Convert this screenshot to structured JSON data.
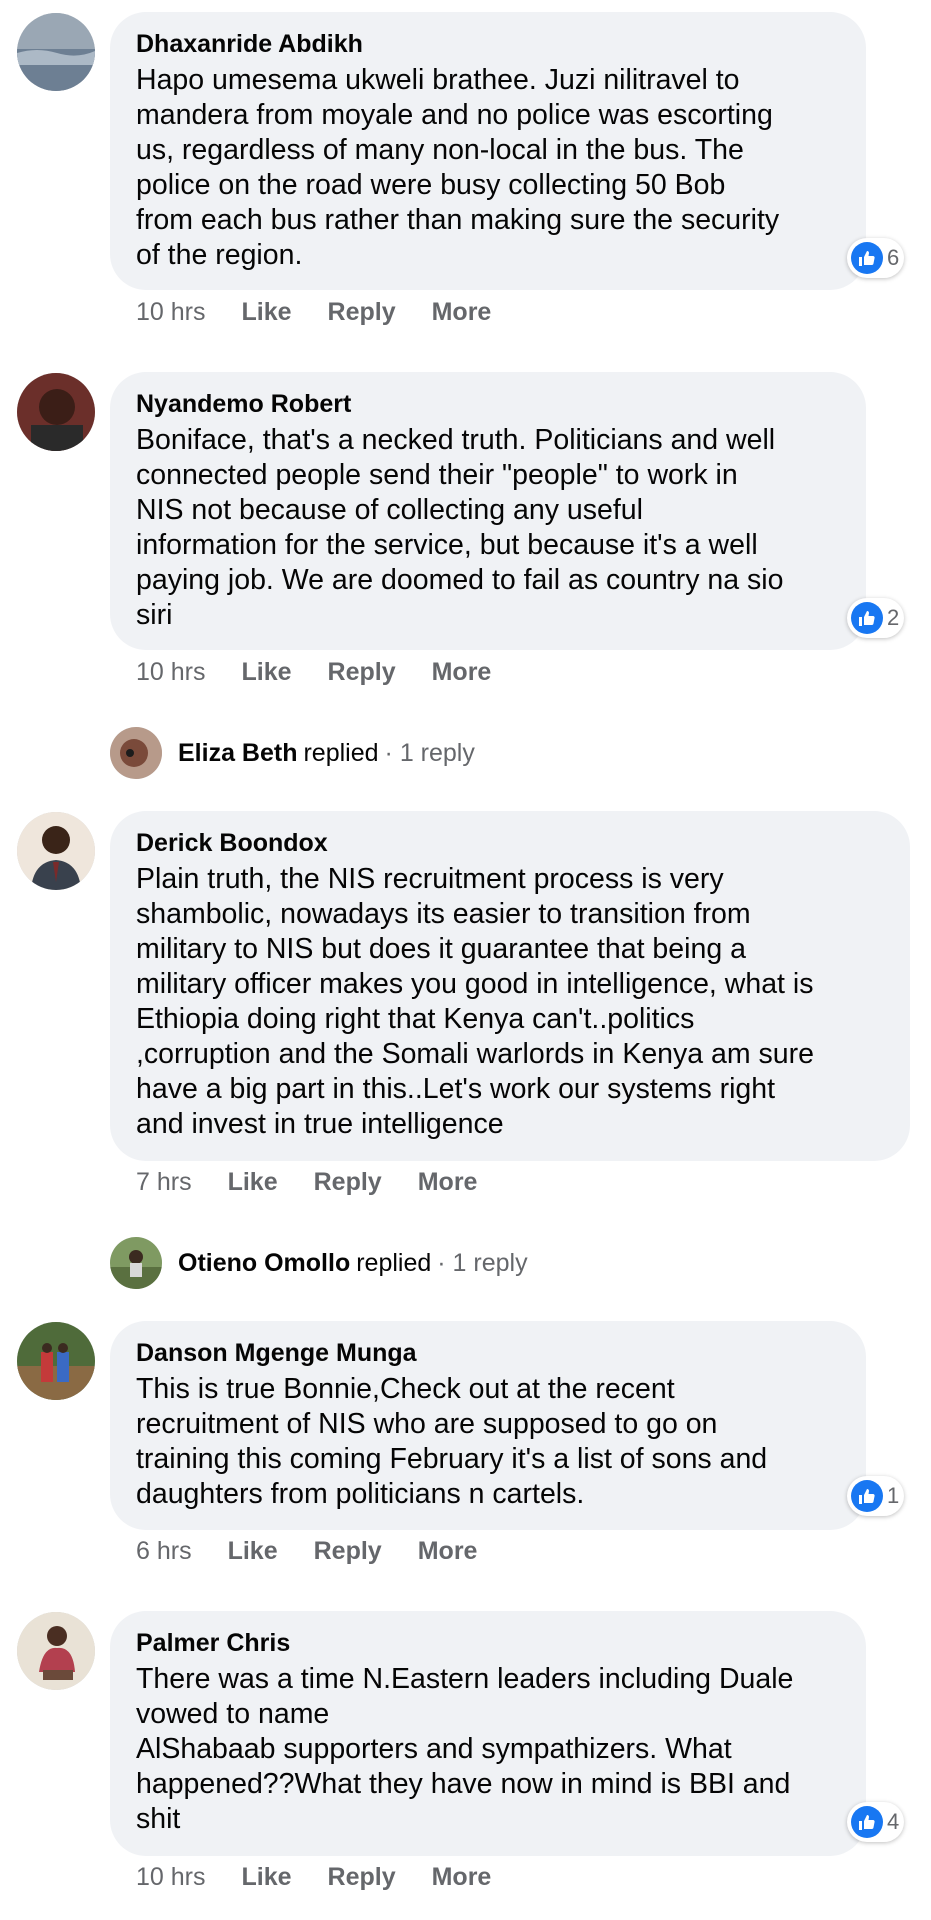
{
  "comments": [
    {
      "author": "Dhaxanride Abdikh",
      "text": "Hapo umesema ukweli brathee. Juzi nilitravel to\nmandera from moyale and no police was escorting\nus, regardless of many non-local in the bus. The\npolice on the road were busy collecting 50 Bob\nfrom each bus rather than making sure the security\nof the region.",
      "likes": "6",
      "time": "10 hrs",
      "like_label": "Like",
      "reply_label": "Reply",
      "more_label": "More"
    },
    {
      "author": "Nyandemo Robert",
      "text": "Boniface, that's a necked truth. Politicians and well\nconnected people send their \"people\" to work in\nNIS not because of collecting any useful\ninformation for the service, but because it's a well\npaying job. We are doomed to fail as country na sio\nsiri",
      "likes": "2",
      "time": "10 hrs",
      "like_label": "Like",
      "reply_label": "Reply",
      "more_label": "More",
      "replied": {
        "name": "Eliza Beth",
        "word": "replied",
        "count": "· 1 reply"
      }
    },
    {
      "author": "Derick Boondox",
      "text": "Plain truth, the NIS recruitment process is very\nshambolic, nowadays its easier to transition from\nmilitary to NIS but does it guarantee that being a\nmilitary officer makes you good in intelligence, what is\nEthiopia doing right that Kenya can't..politics\n,corruption and the Somali warlords in Kenya am sure\nhave a big part in this..Let's work our systems right\nand invest in true intelligence",
      "time": "7 hrs",
      "like_label": "Like",
      "reply_label": "Reply",
      "more_label": "More",
      "replied": {
        "name": "Otieno Omollo",
        "word": "replied",
        "count": "· 1 reply"
      }
    },
    {
      "author": "Danson Mgenge Munga",
      "text": "This is true Bonnie,Check out at the recent\nrecruitment of NIS who are supposed to go on\ntraining this coming February it's a list of sons and\ndaughters from politicians n cartels.",
      "likes": "1",
      "time": "6 hrs",
      "like_label": "Like",
      "reply_label": "Reply",
      "more_label": "More"
    },
    {
      "author": "Palmer Chris",
      "text": "There was a time N.Eastern leaders including Duale\nvowed to name\nAlShabaab supporters and sympathizers. What\nhappened??What they have now in mind is BBI and\nshit",
      "likes": "4",
      "time": "10 hrs",
      "like_label": "Like",
      "reply_label": "Reply",
      "more_label": "More"
    }
  ],
  "colors": {
    "bubble": "#f0f2f5",
    "like_blue": "#1877f2",
    "muted": "#65676b",
    "text": "#050505"
  },
  "icons": {
    "reaction": "thumbs-up-icon"
  }
}
